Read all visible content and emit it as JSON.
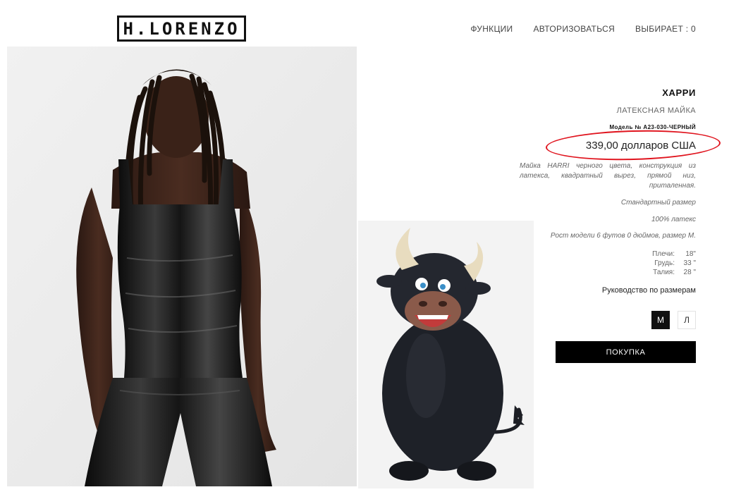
{
  "brand": {
    "logo_text": "H.LORENZO"
  },
  "nav": {
    "features": "ФУНКЦИИ",
    "login": "АВТОРИЗОВАТЬСЯ",
    "cart": "ВЫБИРАЕТ : 0"
  },
  "product": {
    "name": "ХАРРИ",
    "subtitle": "ЛАТЕКСНАЯ МАЙКА",
    "model": "Модель № A23-030-ЧЕРНЫЙ",
    "price": "339,00 долларов США",
    "description": "Майка HARRI черного цвета, конструкция из латекса, квадратный вырез, прямой низ, приталенная.",
    "fit": "Стандартный размер",
    "material": "100% латекс",
    "model_info": "Рост модели 6 футов 0 дюймов, размер М.",
    "measurements": [
      {
        "label": "Плечи:",
        "value": "18\""
      },
      {
        "label": "Грудь:",
        "value": "33 \""
      },
      {
        "label": "Талия:",
        "value": "28 \""
      }
    ],
    "size_guide": "Руководство по размерам",
    "sizes": {
      "selected": "М",
      "other": "Л"
    },
    "buy_label": "ПОКУПКА"
  },
  "colors": {
    "price_circle": "#e0141e",
    "buy_button": "#000000"
  }
}
